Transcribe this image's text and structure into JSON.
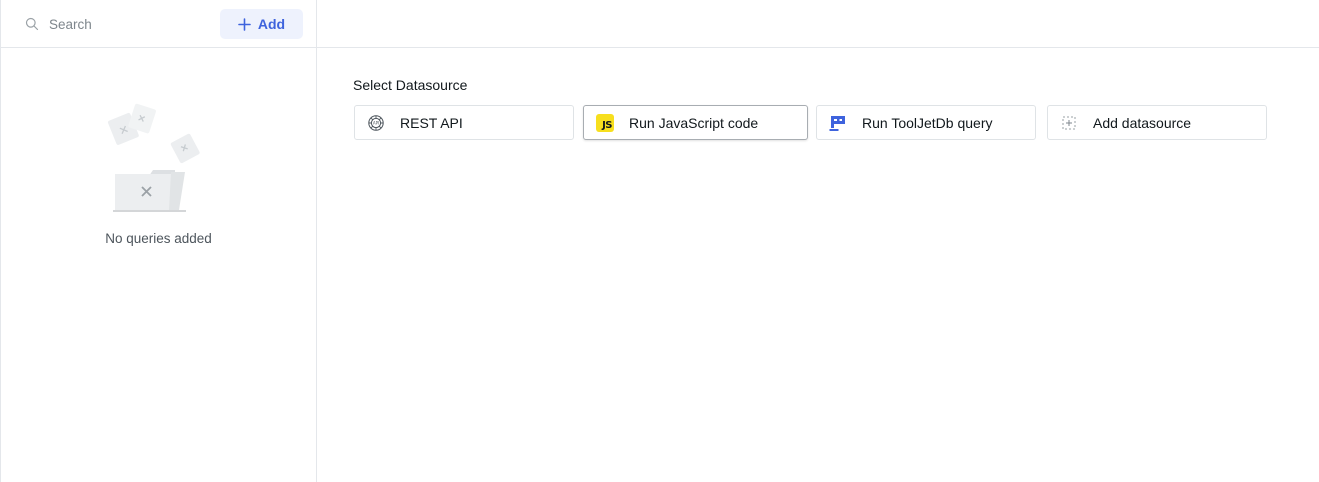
{
  "sidebar": {
    "search": {
      "placeholder": "Search",
      "value": ""
    },
    "add_button": {
      "label": "Add",
      "color": "#3e63dd",
      "background": "#eef2fd"
    },
    "empty_state": {
      "label": "No queries added"
    }
  },
  "main": {
    "section_title": "Select Datasource",
    "datasources": [
      {
        "label": "REST API",
        "icon": "rest-api-icon"
      },
      {
        "label": "Run JavaScript code",
        "icon": "javascript-icon",
        "badge": "JS",
        "selected": true
      },
      {
        "label": "Run ToolJetDb query",
        "icon": "tooljetdb-icon"
      },
      {
        "label": "Add datasource",
        "icon": "add-datasource-icon"
      }
    ]
  },
  "colors": {
    "accent": "#3e63dd",
    "js_yellow": "#f7df1e",
    "border": "#e4e7eb"
  }
}
